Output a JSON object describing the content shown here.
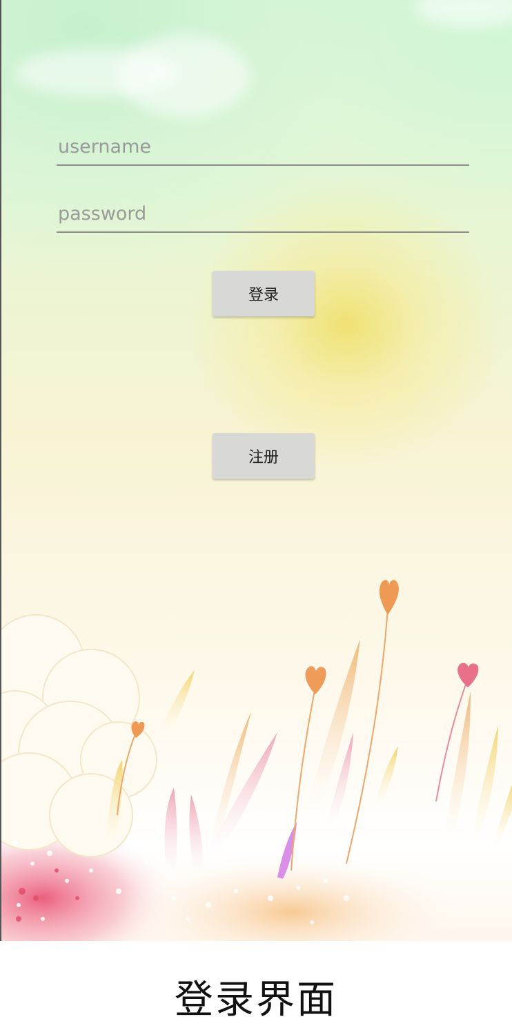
{
  "login_form": {
    "username_placeholder": "username",
    "password_placeholder": "password",
    "login_button": "登录",
    "register_button": "注册"
  },
  "caption": "登录界面",
  "colors": {
    "sky_green": "#d6f5d8",
    "sun_yellow": "#f0e06e",
    "button_gray": "#d8d8d6",
    "underline_gray": "#8c8c8c",
    "heart_orange": "#ee9a55",
    "heart_pink": "#e8718a"
  }
}
